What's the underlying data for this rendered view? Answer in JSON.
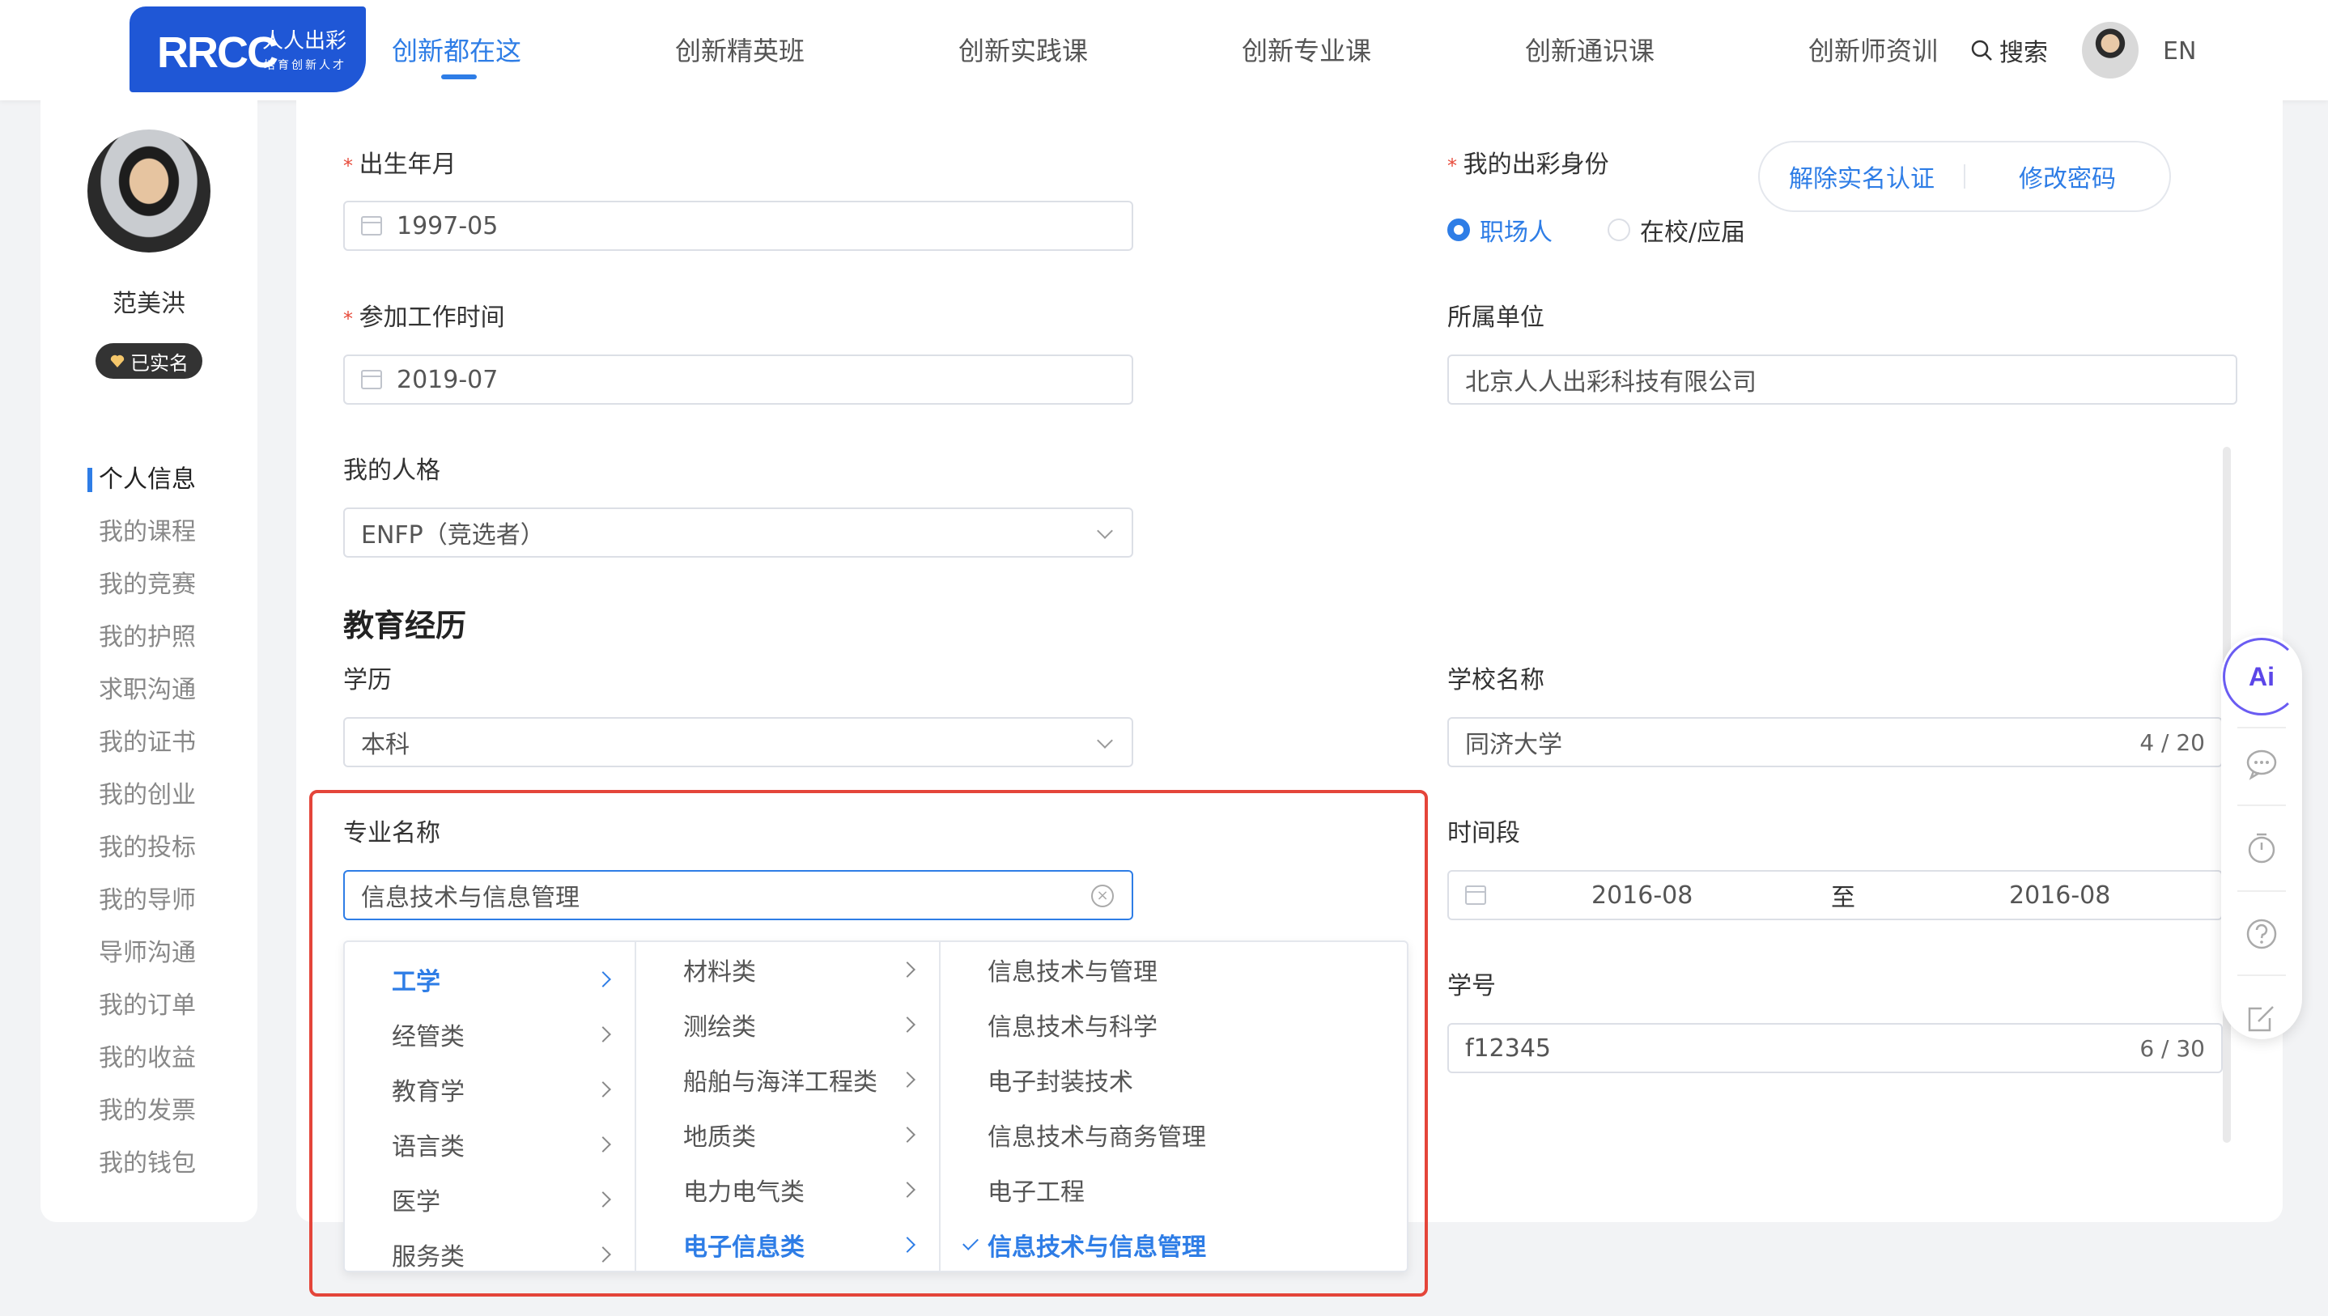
{
  "brand": {
    "logo_main": "RRCC",
    "logo_cn": "人人出彩",
    "logo_sub": "培育创新人才"
  },
  "nav": {
    "items": [
      "创新都在这",
      "创新精英班",
      "创新实践课",
      "创新专业课",
      "创新通识课",
      "创新师资训"
    ],
    "active_index": 0,
    "search_label": "搜索",
    "lang_label": "EN"
  },
  "sidebar": {
    "user_name": "范美洪",
    "verified_label": "已实名",
    "menu": [
      "个人信息",
      "我的课程",
      "我的竞赛",
      "我的护照",
      "求职沟通",
      "我的证书",
      "我的创业",
      "我的投标",
      "我的导师",
      "导师沟通",
      "我的订单",
      "我的收益",
      "我的发票",
      "我的钱包"
    ],
    "active_index": 0
  },
  "form": {
    "birth": {
      "label": "出生年月",
      "value": "1997-05"
    },
    "work_start": {
      "label": "参加工作时间",
      "value": "2019-07"
    },
    "personality": {
      "label": "我的人格",
      "value": "ENFP（竞选者）"
    },
    "identity": {
      "label": "我的出彩身份",
      "options": [
        "职场人",
        "在校/应届"
      ],
      "selected_index": 0
    },
    "account_actions": {
      "unbind": "解除实名认证",
      "change_password": "修改密码"
    },
    "company": {
      "label": "所属单位",
      "value": "北京人人出彩科技有限公司"
    }
  },
  "education": {
    "heading": "教育经历",
    "degree": {
      "label": "学历",
      "value": "本科"
    },
    "school": {
      "label": "学校名称",
      "value": "同济大学",
      "counter": "4 / 20"
    },
    "major": {
      "label": "专业名称",
      "value": "信息技术与信息管理"
    },
    "period": {
      "label": "时间段",
      "start": "2016-08",
      "separator": "至",
      "end": "2016-08"
    },
    "student_id": {
      "label": "学号",
      "value": "f12345",
      "counter": "6 / 30"
    }
  },
  "cascader": {
    "col1": [
      "工学",
      "经管类",
      "教育学",
      "语言类",
      "医学",
      "服务类"
    ],
    "col1_selected": 0,
    "col2": [
      "材料类",
      "测绘类",
      "船舶与海洋工程类",
      "地质类",
      "电力电气类",
      "电子信息类"
    ],
    "col2_selected": 5,
    "col3": [
      "信息技术与管理",
      "信息技术与科学",
      "电子封装技术",
      "信息技术与商务管理",
      "电子工程",
      "信息技术与信息管理"
    ],
    "col3_selected": 5
  },
  "float_tools": {
    "ai_label": "Ai",
    "icons": [
      "chat-icon",
      "timer-icon",
      "help-icon",
      "edit-icon"
    ]
  },
  "colors": {
    "accent": "#2e7de6",
    "highlight_border": "#e4453a",
    "logo_bg": "#1f57d6"
  }
}
